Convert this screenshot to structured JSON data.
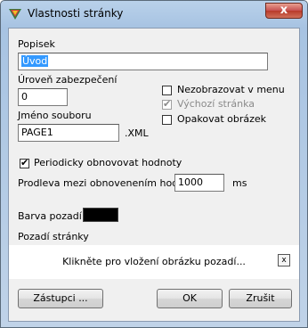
{
  "window": {
    "title": "Vlastnosti stránky",
    "close_label": "x"
  },
  "description": {
    "label": "Popisek",
    "value": "Úvod"
  },
  "security": {
    "label": "Úroveň zabezpečení",
    "value": "0"
  },
  "file": {
    "label": "Jméno souboru",
    "value": "PAGE1",
    "extension": ".XML"
  },
  "checkboxes": [
    {
      "label": "Nezobrazovat v menu",
      "checked": false,
      "disabled": false
    },
    {
      "label": "Výchozí stránka",
      "checked": true,
      "disabled": true
    },
    {
      "label": "Opakovat obrázek",
      "checked": false,
      "disabled": false
    }
  ],
  "refresh": {
    "label": "Periodicky obnovovat hodnoty",
    "checked": true
  },
  "interval": {
    "label": "Prodleva mezi obnovenením hodnot",
    "value": "1000",
    "unit": "ms"
  },
  "bg_color": {
    "label": "Barva pozadí",
    "color": "#000000"
  },
  "bg_image": {
    "label": "Pozadí stránky",
    "placeholder": "Klikněte pro vložení obrázku pozadí...",
    "clear_label": "x"
  },
  "buttons": {
    "shortcuts": "Zástupci ...",
    "ok": "OK",
    "cancel": "Zrušit"
  }
}
